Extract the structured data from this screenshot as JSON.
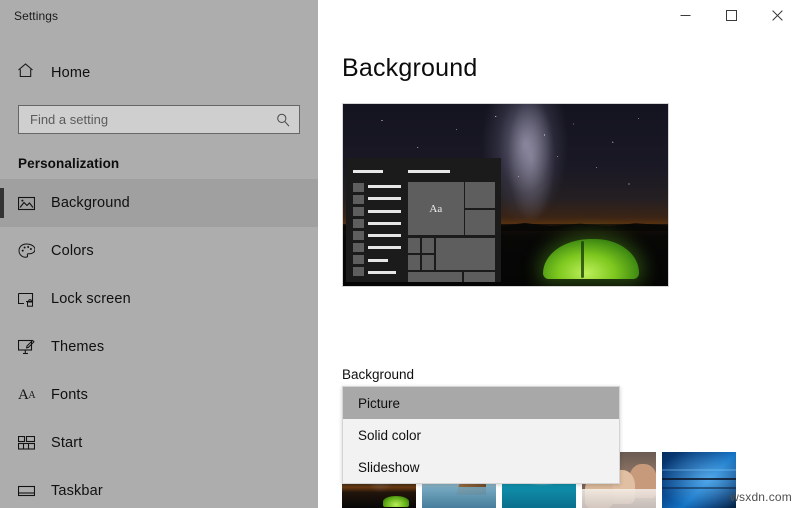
{
  "window": {
    "app_title": "Settings",
    "controls": [
      {
        "name": "minimize",
        "label": "Minimize"
      },
      {
        "name": "maximize",
        "label": "Maximize"
      },
      {
        "name": "close",
        "label": "Close"
      }
    ]
  },
  "sidebar": {
    "home": {
      "label": "Home",
      "icon": "home-icon"
    },
    "search": {
      "value": "",
      "placeholder": "Find a setting",
      "icon": "search-icon"
    },
    "section_title": "Personalization",
    "items": [
      {
        "label": "Background",
        "icon": "picture-icon",
        "selected": true
      },
      {
        "label": "Colors",
        "icon": "palette-icon",
        "selected": false
      },
      {
        "label": "Lock screen",
        "icon": "lock-screen-icon",
        "selected": false
      },
      {
        "label": "Themes",
        "icon": "themes-icon",
        "selected": false
      },
      {
        "label": "Fonts",
        "icon": "fonts-icon",
        "selected": false
      },
      {
        "label": "Start",
        "icon": "start-icon",
        "selected": false
      },
      {
        "label": "Taskbar",
        "icon": "taskbar-icon",
        "selected": false
      }
    ]
  },
  "main": {
    "page_title": "Background",
    "preview": {
      "alt": "Desktop preview: milky way night sky over a glowing green tent",
      "start_menu_tile_text": "Aa"
    },
    "background_field": {
      "label": "Background",
      "selected_value": "Picture",
      "options": [
        "Picture",
        "Solid color",
        "Slideshow"
      ]
    },
    "choose_picture": {
      "thumbnails": [
        {
          "name": "night-sky-tent",
          "selected": true
        },
        {
          "name": "beach-sea-stack",
          "selected": false
        },
        {
          "name": "turquoise-ocean",
          "selected": false
        },
        {
          "name": "group-photo",
          "selected": false
        },
        {
          "name": "windows-10-hero",
          "selected": false
        }
      ]
    }
  },
  "watermark": {
    "text": "wsxdn.com"
  },
  "colors": {
    "sidebar_bg": "#adadad",
    "content_bg": "#ffffff",
    "selected_nav_bg": "#a0a0a0",
    "dropdown_bg": "#f2f2f2",
    "dropdown_selected_bg": "#a8a8a8",
    "accent": "#0078d7"
  }
}
